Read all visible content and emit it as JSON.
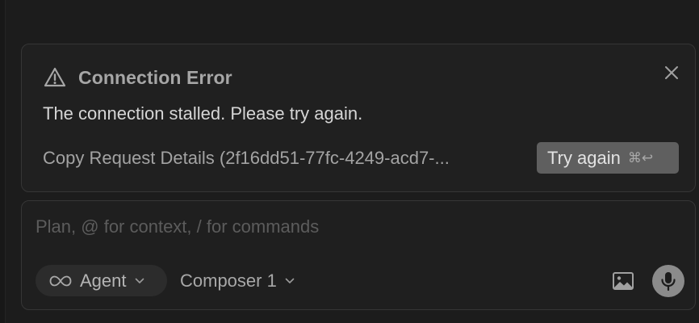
{
  "error": {
    "title": "Connection Error",
    "message": "The connection stalled. Please try again.",
    "copy_details_label": "Copy Request Details (2f16dd51-77fc-4249-acd7-...",
    "try_again_label": "Try again",
    "try_again_shortcut": "⌘↩"
  },
  "composer": {
    "placeholder": "Plan, @ for context, / for commands",
    "value": "",
    "mode_label": "Agent",
    "model_label": "Composer 1"
  },
  "icons": {
    "warning": "warning-triangle-icon",
    "close": "close-icon",
    "infinity": "infinity-icon",
    "chevron": "chevron-down-icon",
    "image": "image-icon",
    "microphone": "microphone-icon"
  },
  "colors": {
    "background": "#1c1c1c",
    "card": "#202020",
    "border": "#363636",
    "try_again_bg": "#5f5f5f",
    "mic_bg": "#8b8b8b"
  }
}
